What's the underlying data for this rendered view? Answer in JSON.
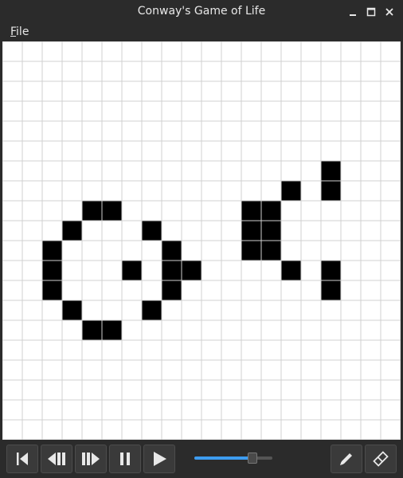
{
  "window": {
    "title": "Conway's Game of Life",
    "controls": [
      "minimize-icon",
      "maximize-icon",
      "close-icon"
    ]
  },
  "menu": {
    "file_mnemonic": "F",
    "file_rest": "ile"
  },
  "grid": {
    "columns": 20,
    "rows": 20,
    "live_color": "#000000",
    "dead_color": "#ffffff",
    "line_color": "#d0d0d0",
    "live_cells": [
      [
        4,
        8
      ],
      [
        5,
        8
      ],
      [
        3,
        9
      ],
      [
        7,
        9
      ],
      [
        2,
        10
      ],
      [
        8,
        10
      ],
      [
        2,
        11
      ],
      [
        6,
        11
      ],
      [
        8,
        11
      ],
      [
        9,
        11
      ],
      [
        2,
        12
      ],
      [
        8,
        12
      ],
      [
        3,
        13
      ],
      [
        7,
        13
      ],
      [
        4,
        14
      ],
      [
        5,
        14
      ],
      [
        16,
        6
      ],
      [
        14,
        7
      ],
      [
        16,
        7
      ],
      [
        12,
        8
      ],
      [
        13,
        8
      ],
      [
        12,
        9
      ],
      [
        13,
        9
      ],
      [
        12,
        10
      ],
      [
        13,
        10
      ],
      [
        14,
        11
      ],
      [
        16,
        11
      ],
      [
        16,
        12
      ]
    ]
  },
  "toolbar": {
    "buttons": [
      "skip-to-start-icon",
      "step-back-icon",
      "step-forward-icon",
      "pause-icon",
      "play-icon",
      "pencil-icon",
      "eraser-icon"
    ],
    "speed_fraction": 0.78,
    "accent_color": "#3d9cf0"
  }
}
